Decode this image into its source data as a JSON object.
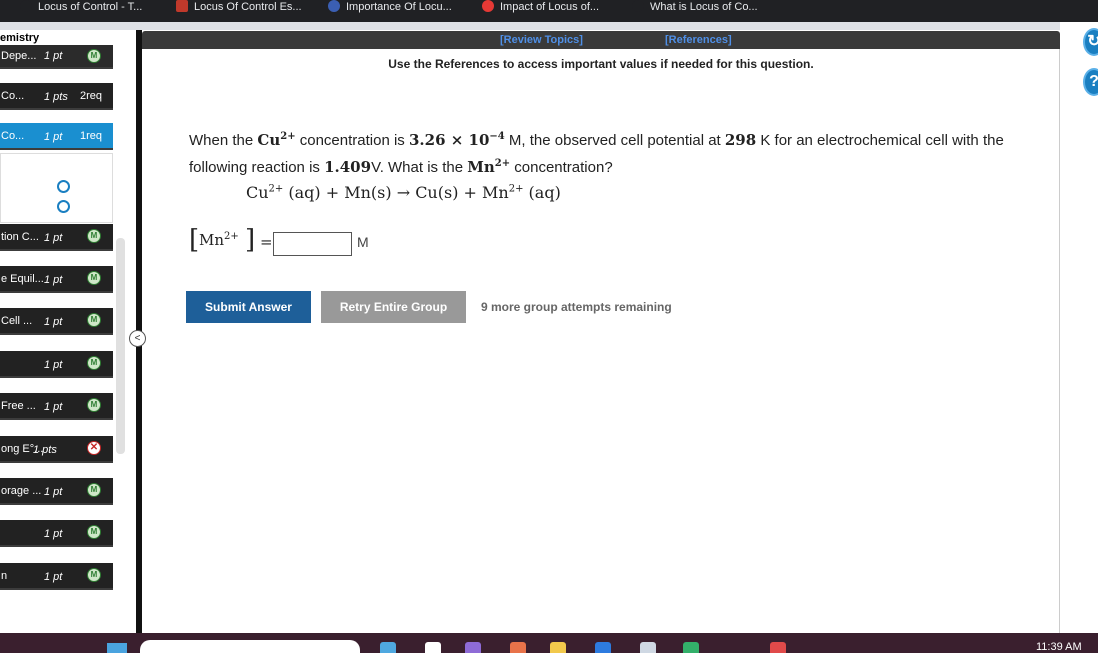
{
  "tabs": [
    {
      "label": "Locus of Control - T...",
      "icon": "dot-icon"
    },
    {
      "label": "Locus Of Control Es...",
      "icon": "site-icon"
    },
    {
      "label": "Importance Of Locu...",
      "icon": "circle-icon"
    },
    {
      "label": "Impact of Locus of...",
      "icon": "s-logo-icon"
    },
    {
      "label": "What is Locus of Co...",
      "icon": "page-icon"
    }
  ],
  "sidebar": {
    "course_title": "emistry",
    "items": [
      {
        "name": "Depe...",
        "points": "1 pt",
        "req": "",
        "status": "M"
      },
      {
        "name": "Co...",
        "points": "1 pts",
        "req": "2req",
        "status": ""
      },
      {
        "name": "Co...",
        "points": "1 pt",
        "req": "1req",
        "status": ""
      },
      {
        "name": "tion C...",
        "points": "1 pt",
        "req": "",
        "status": "M"
      },
      {
        "name": "e Equil...",
        "points": "1 pt",
        "req": "",
        "status": "M"
      },
      {
        "name": "Cell ...",
        "points": "1 pt",
        "req": "",
        "status": "M"
      },
      {
        "name": "",
        "points": "1 pt",
        "req": "",
        "status": "M"
      },
      {
        "name": "Free ...",
        "points": "1 pt",
        "req": "",
        "status": "M"
      },
      {
        "name": "ong E°...",
        "points": "1 pts",
        "req": "",
        "status": "X"
      },
      {
        "name": "orage ...",
        "points": "1 pt",
        "req": "",
        "status": "M"
      },
      {
        "name": "",
        "points": "1 pt",
        "req": "",
        "status": "M"
      },
      {
        "name": "n",
        "points": "1 pt",
        "req": "",
        "status": "M"
      }
    ],
    "collapse_label": "<"
  },
  "toolbar": {
    "review_topics": "[Review Topics]",
    "references": "[References]",
    "ref_note": "Use the References to access important values if needed for this question."
  },
  "question": {
    "t1": "When the ",
    "ion1": "Cu",
    "ion1_charge": "2+",
    "t2": " concentration is ",
    "conc": "3.26 × 10",
    "conc_exp": "−4",
    "t3": " M, the observed cell potential at ",
    "temp": "298",
    "t4": " K for an electrochemical cell with the following reaction is ",
    "potential": "1.409",
    "t5": "V. What is the ",
    "ion2": "Mn",
    "ion2_charge": "2+",
    "t6": " concentration?"
  },
  "equation": {
    "lhs1": "Cu",
    "lhs1_charge": "2+",
    "lhs1_state": " (aq) + Mn(s) → Cu(s) + Mn",
    "rhs_charge": "2+",
    "rhs_state": " (aq)"
  },
  "answer": {
    "species": "Mn",
    "charge": "2+",
    "left_bracket": "[",
    "right_bracket": "]",
    "equals": "=",
    "value": "",
    "unit": "M"
  },
  "buttons": {
    "submit": "Submit Answer",
    "retry": "Retry Entire Group",
    "attempts": "9 more group attempts remaining"
  },
  "taskbar": {
    "clock": "11:39 AM"
  },
  "colors": {
    "accent": "#1e5f99",
    "active_nav": "#1a8fd0",
    "correct": "#2e7d32",
    "incorrect": "#c62828"
  }
}
